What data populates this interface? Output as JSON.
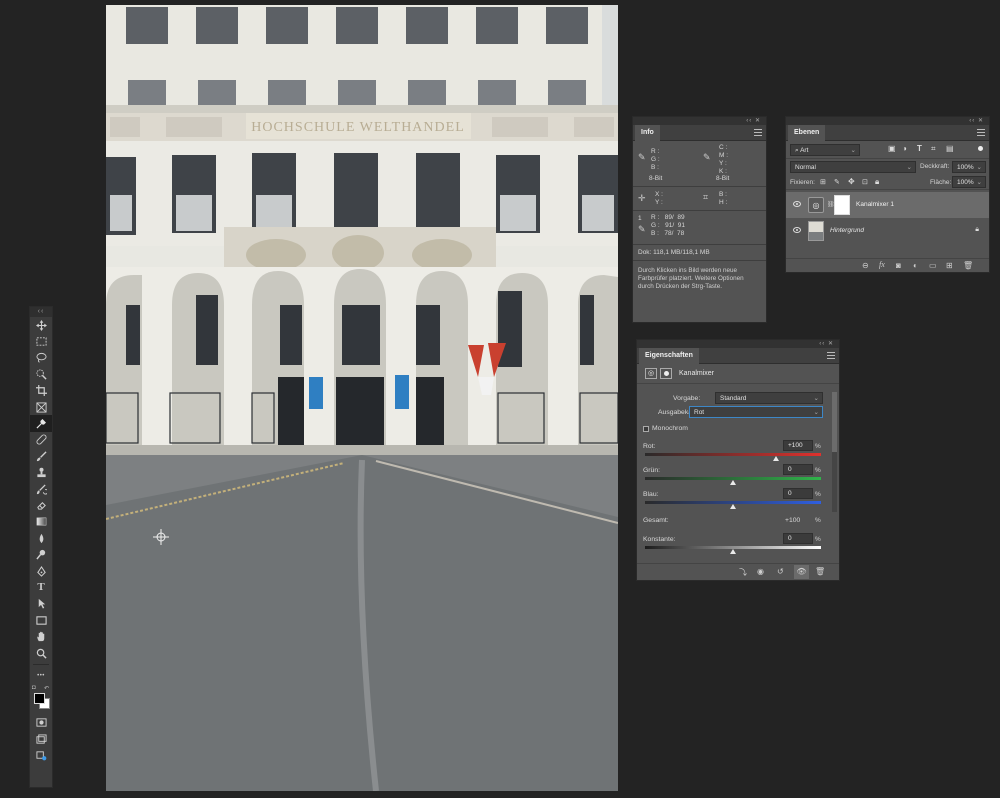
{
  "toolbar": {
    "header": "‹‹",
    "tools": [
      "move-icon",
      "marquee-icon",
      "lasso-icon",
      "quick-select-icon",
      "crop-icon",
      "frame-icon",
      "eyedropper-icon",
      "healing-icon",
      "brush-icon",
      "stamp-icon",
      "history-brush-icon",
      "eraser-icon",
      "gradient-icon",
      "blur-icon",
      "dodge-icon",
      "pen-icon",
      "type-icon",
      "path-select-icon",
      "rectangle-icon",
      "hand-icon",
      "zoom-icon"
    ],
    "type_tool_glyph": "T",
    "more_glyph": "•••"
  },
  "photo": {
    "building_sign": "HOCHSCHULE WELTHANDEL",
    "colors": {
      "facade": "#e9e8e1",
      "road": "#7d8082",
      "window": "#3b3f44",
      "sky": "#dfe3e3"
    }
  },
  "info": {
    "header": "‹‹  ✕",
    "tab": "Info",
    "rgb_labels": "R :\nG :\nB :",
    "bit_left": "8-Bit",
    "cmyk_labels": "C :\nM :\nY :\nK :",
    "bit_right": "8-Bit",
    "xy_labels": "X :\nY :",
    "wh_labels": "B :\nH :",
    "sample_index": "1",
    "sample_values": "R :   89/  89\nG :   91/  91\nB :   78/  78",
    "doc_size": "Dok: 118,1 MB/118,1 MB",
    "hint": "Durch Klicken ins Bild werden neue Farbprüfer platziert. Weitere Optionen durch Drücken der Strg-Taste."
  },
  "layers": {
    "header": "‹‹  ✕",
    "tab": "Ebenen",
    "filter_kind": "Art",
    "blend_mode": "Normal",
    "opacity_label": "Deckkraft:",
    "opacity_value": "100%",
    "lock_label": "Fixieren:",
    "fill_label": "Fläche:",
    "fill_value": "100%",
    "items": [
      {
        "name": "Kanalmixer 1",
        "selected": true
      },
      {
        "name": "Hintergrund",
        "selected": false
      }
    ],
    "footer_icons": [
      "link-icon",
      "fx-icon",
      "mask-icon",
      "adjustment-icon",
      "group-icon",
      "new-layer-icon",
      "trash-icon"
    ],
    "fx_label": "fx"
  },
  "properties": {
    "header": "‹‹  ✕",
    "tab": "Eigenschaften",
    "title": "Kanalmixer",
    "preset_label": "Vorgabe:",
    "preset_value": "Standard",
    "output_label": "Ausgabekanal:",
    "output_value": "Rot",
    "monochrome_label": "Monochrom",
    "sliders": [
      {
        "label": "Rot:",
        "value": "+100",
        "fraction": 0.75,
        "color": "red"
      },
      {
        "label": "Grün:",
        "value": "0",
        "fraction": 0.5,
        "color": "green"
      },
      {
        "label": "Blau:",
        "value": "0",
        "fraction": 0.5,
        "color": "blue"
      }
    ],
    "total_label": "Gesamt:",
    "total_value": "+100",
    "constant_label": "Konstante:",
    "constant_value": "0",
    "constant_fraction": 0.5,
    "percent": "%"
  }
}
